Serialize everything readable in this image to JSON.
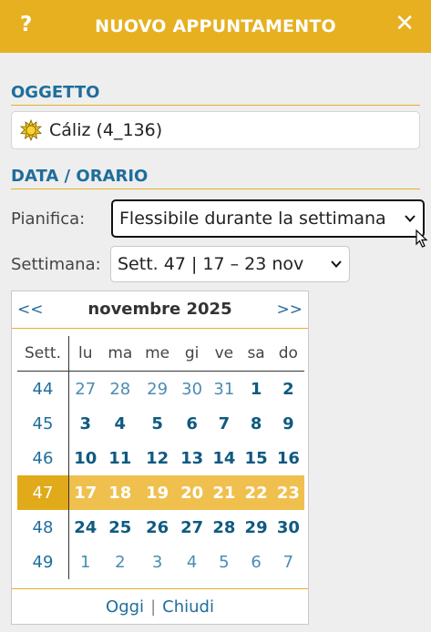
{
  "header": {
    "title": "NUOVO APPUNTAMENTO",
    "help_icon": "?",
    "close_icon": "✕",
    "background": "#e6b021"
  },
  "object_section": {
    "title": "OGGETTO",
    "value": "Cáliz (4_136)",
    "icon": "sun-icon"
  },
  "datetime_section": {
    "title": "DATA / ORARIO",
    "plan_label": "Pianifica:",
    "plan_value": "Flessibile durante la settimana",
    "week_label": "Settimana:",
    "week_value": "Sett. 47 | 17 – 23 nov"
  },
  "calendar": {
    "prev": "<<",
    "next": ">>",
    "month": "novembre 2025",
    "week_header": "Sett.",
    "day_headers": [
      "lu",
      "ma",
      "me",
      "gi",
      "ve",
      "sa",
      "do"
    ],
    "selected_week": 47,
    "weeks": [
      {
        "week": "44",
        "days": [
          {
            "d": "27",
            "other": true
          },
          {
            "d": "28",
            "other": true
          },
          {
            "d": "29",
            "other": true
          },
          {
            "d": "30",
            "other": true
          },
          {
            "d": "31",
            "other": true
          },
          {
            "d": "1",
            "other": false
          },
          {
            "d": "2",
            "other": false
          }
        ]
      },
      {
        "week": "45",
        "days": [
          {
            "d": "3",
            "other": false
          },
          {
            "d": "4",
            "other": false
          },
          {
            "d": "5",
            "other": false
          },
          {
            "d": "6",
            "other": false
          },
          {
            "d": "7",
            "other": false
          },
          {
            "d": "8",
            "other": false
          },
          {
            "d": "9",
            "other": false
          }
        ]
      },
      {
        "week": "46",
        "days": [
          {
            "d": "10",
            "other": false
          },
          {
            "d": "11",
            "other": false
          },
          {
            "d": "12",
            "other": false
          },
          {
            "d": "13",
            "other": false
          },
          {
            "d": "14",
            "other": false
          },
          {
            "d": "15",
            "other": false
          },
          {
            "d": "16",
            "other": false
          }
        ]
      },
      {
        "week": "47",
        "days": [
          {
            "d": "17",
            "other": false
          },
          {
            "d": "18",
            "other": false
          },
          {
            "d": "19",
            "other": false
          },
          {
            "d": "20",
            "other": false
          },
          {
            "d": "21",
            "other": false
          },
          {
            "d": "22",
            "other": false
          },
          {
            "d": "23",
            "other": false
          }
        ]
      },
      {
        "week": "48",
        "days": [
          {
            "d": "24",
            "other": false
          },
          {
            "d": "25",
            "other": false
          },
          {
            "d": "26",
            "other": false
          },
          {
            "d": "27",
            "other": false
          },
          {
            "d": "28",
            "other": false
          },
          {
            "d": "29",
            "other": false
          },
          {
            "d": "30",
            "other": false
          }
        ]
      },
      {
        "week": "49",
        "days": [
          {
            "d": "1",
            "other": true
          },
          {
            "d": "2",
            "other": true
          },
          {
            "d": "3",
            "other": true
          },
          {
            "d": "4",
            "other": true
          },
          {
            "d": "5",
            "other": true
          },
          {
            "d": "6",
            "other": true
          },
          {
            "d": "7",
            "other": true
          }
        ]
      }
    ],
    "footer": {
      "today": "Oggi",
      "separator": "|",
      "close": "Chiudi"
    }
  },
  "colors": {
    "accent": "#e6b021",
    "link": "#1f6e9c",
    "selected_row": "#efc04e"
  }
}
